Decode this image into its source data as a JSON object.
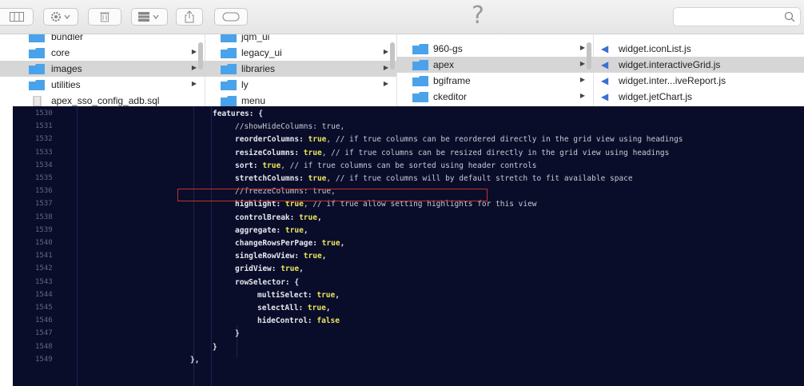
{
  "toolbar": {
    "help_glyph": "?",
    "search": {
      "placeholder": "",
      "value": ""
    },
    "icons": [
      "column-view-icon",
      "gear-icon",
      "trash-icon",
      "grid-view-icon",
      "share-icon",
      "tag-icon",
      "search-icon"
    ]
  },
  "finder": {
    "column1": {
      "items": [
        {
          "label": "bundler",
          "folder": true,
          "selected": false,
          "has_arrow": false
        },
        {
          "label": "core",
          "folder": true,
          "selected": false,
          "has_arrow": true
        },
        {
          "label": "images",
          "folder": true,
          "selected": true,
          "has_arrow": true
        },
        {
          "label": "utilities",
          "folder": true,
          "selected": false,
          "has_arrow": true
        },
        {
          "label": "apex_sso_config_adb.sql",
          "folder": false,
          "selected": false,
          "has_arrow": false
        }
      ]
    },
    "column2": {
      "items": [
        {
          "label": "jqm_ui",
          "folder": true,
          "selected": false
        },
        {
          "label": "legacy_ui",
          "folder": true,
          "selected": false
        },
        {
          "label": "libraries",
          "folder": true,
          "selected": true
        },
        {
          "label": "ly",
          "folder": true,
          "selected": false
        },
        {
          "label": "menu",
          "folder": true,
          "selected": false
        }
      ]
    },
    "column3": {
      "items": [
        {
          "label": "960-gs",
          "selected": false
        },
        {
          "label": "apex",
          "selected": true
        },
        {
          "label": "bgiframe",
          "selected": false
        },
        {
          "label": "ckeditor",
          "selected": false
        }
      ]
    },
    "column4": {
      "items": [
        {
          "label": "widget.iconList.js",
          "selected": false
        },
        {
          "label": "widget.interactiveGrid.js",
          "selected": true
        },
        {
          "label": "widget.inter...iveReport.js",
          "selected": false
        },
        {
          "label": "widget.jetChart.js",
          "selected": false
        }
      ]
    }
  },
  "editor": {
    "lines": [
      {
        "num": "1530",
        "tokens": [
          {
            "t": "features: {",
            "c": "k"
          }
        ],
        "indent": 0
      },
      {
        "num": "1531",
        "tokens": [
          {
            "t": "//showHideColumns: true,",
            "c": "c"
          }
        ],
        "indent": 1
      },
      {
        "num": "1532",
        "tokens": [
          {
            "t": "reorderColumns: ",
            "c": "k"
          },
          {
            "t": "true",
            "c": "v"
          },
          {
            "t": ", // if true columns can be reordered directly in the grid view using headings",
            "c": "c"
          }
        ],
        "indent": 1
      },
      {
        "num": "1533",
        "tokens": [
          {
            "t": "resizeColumns: ",
            "c": "k"
          },
          {
            "t": "true",
            "c": "v"
          },
          {
            "t": ", // if true columns can be resized directly in the grid view using headings",
            "c": "c"
          }
        ],
        "indent": 1
      },
      {
        "num": "1534",
        "tokens": [
          {
            "t": "sort: ",
            "c": "k"
          },
          {
            "t": "true",
            "c": "v"
          },
          {
            "t": ", // if true columns can be sorted using header controls",
            "c": "c"
          }
        ],
        "indent": 1
      },
      {
        "num": "1535",
        "tokens": [
          {
            "t": "stretchColumns: ",
            "c": "k"
          },
          {
            "t": "true",
            "c": "v"
          },
          {
            "t": ", // if true columns will by default stretch to fit available space",
            "c": "c"
          }
        ],
        "indent": 1
      },
      {
        "num": "1536",
        "tokens": [
          {
            "t": "//freezeColumns: true,",
            "c": "c"
          }
        ],
        "indent": 1
      },
      {
        "num": "1537",
        "tokens": [
          {
            "t": "highlight: ",
            "c": "k"
          },
          {
            "t": "true",
            "c": "v"
          },
          {
            "t": ", // if true allow setting highlights for this view",
            "c": "c"
          }
        ],
        "indent": 1
      },
      {
        "num": "1538",
        "tokens": [
          {
            "t": "controlBreak: ",
            "c": "k"
          },
          {
            "t": "true",
            "c": "v"
          },
          {
            "t": ",",
            "c": "p"
          }
        ],
        "indent": 1
      },
      {
        "num": "1539",
        "tokens": [
          {
            "t": "aggregate: ",
            "c": "k"
          },
          {
            "t": "true",
            "c": "v"
          },
          {
            "t": ",",
            "c": "p"
          }
        ],
        "indent": 1
      },
      {
        "num": "1540",
        "tokens": [
          {
            "t": "changeRowsPerPage: ",
            "c": "k"
          },
          {
            "t": "true",
            "c": "v"
          },
          {
            "t": ",",
            "c": "p"
          }
        ],
        "indent": 1
      },
      {
        "num": "1541",
        "tokens": [
          {
            "t": "singleRowView: ",
            "c": "k"
          },
          {
            "t": "true",
            "c": "v"
          },
          {
            "t": ",",
            "c": "p"
          }
        ],
        "indent": 1
      },
      {
        "num": "1542",
        "tokens": [
          {
            "t": "gridView: ",
            "c": "k"
          },
          {
            "t": "true",
            "c": "v"
          },
          {
            "t": ",",
            "c": "p"
          }
        ],
        "indent": 1
      },
      {
        "num": "1543",
        "tokens": [
          {
            "t": "rowSelector: {",
            "c": "k"
          }
        ],
        "indent": 1
      },
      {
        "num": "1544",
        "tokens": [
          {
            "t": "multiSelect: ",
            "c": "k"
          },
          {
            "t": "true",
            "c": "v"
          },
          {
            "t": ",",
            "c": "p"
          }
        ],
        "indent": 2
      },
      {
        "num": "1545",
        "tokens": [
          {
            "t": "selectAll: ",
            "c": "k"
          },
          {
            "t": "true",
            "c": "v"
          },
          {
            "t": ",",
            "c": "p"
          }
        ],
        "indent": 2
      },
      {
        "num": "1546",
        "tokens": [
          {
            "t": "hideControl: ",
            "c": "k"
          },
          {
            "t": "false",
            "c": "v"
          }
        ],
        "indent": 2
      },
      {
        "num": "1547",
        "tokens": [
          {
            "t": "}",
            "c": "k"
          }
        ],
        "indent": 1
      },
      {
        "num": "1548",
        "tokens": [
          {
            "t": "}",
            "c": "k"
          }
        ],
        "indent": 0
      },
      {
        "num": "1549",
        "tokens": [
          {
            "t": "},",
            "c": "k"
          }
        ],
        "indent": -1
      }
    ],
    "highlighted_line": "1536",
    "highlight_color": "#c0322b"
  },
  "colors": {
    "editor_bg": "#0a0d2a",
    "keyword": "#e7e7ee",
    "value": "#e9e55a",
    "folder_blue": "#4aa3ea",
    "selection_gray": "#d6d6d6"
  }
}
